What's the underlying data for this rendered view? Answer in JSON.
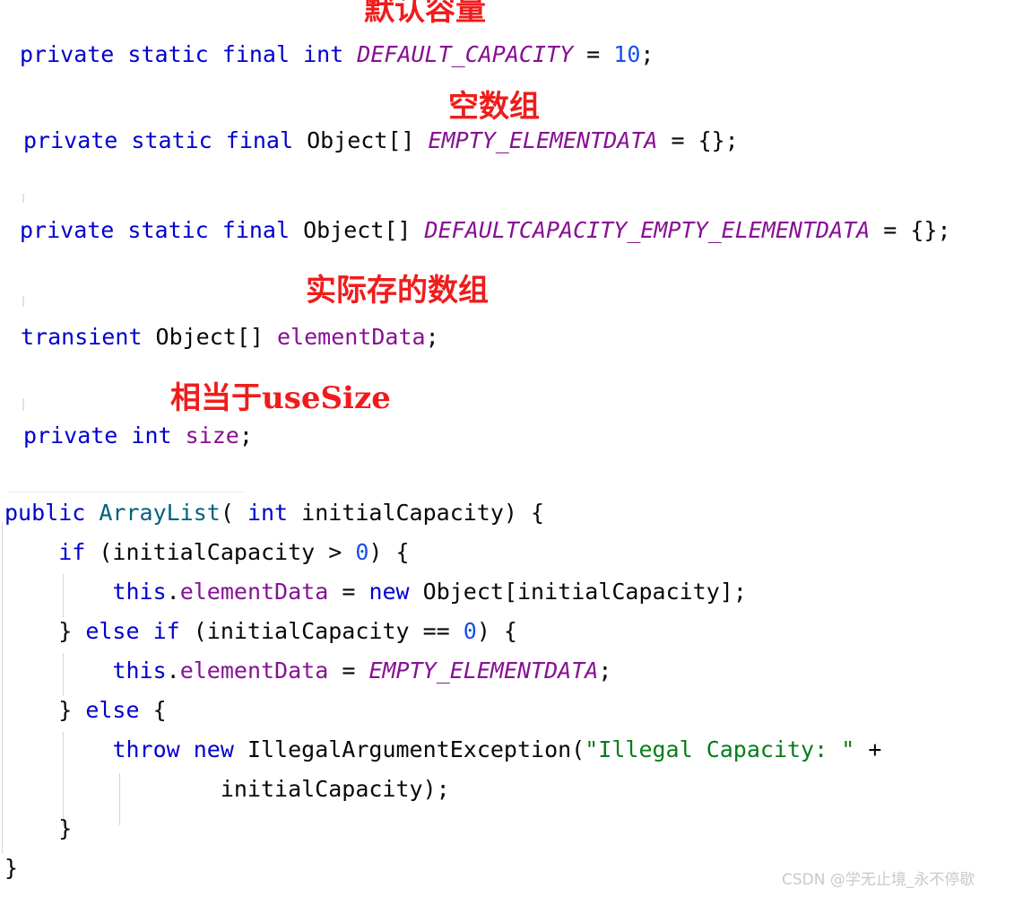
{
  "document": {
    "kind": "code-screenshot",
    "language": "Java",
    "class_context": "ArrayList",
    "background_color": "#ffffff"
  },
  "palette": {
    "keyword": "#0000d0",
    "constant": "#871094",
    "field": "#871094",
    "type": "#00627a",
    "string": "#067d17",
    "number": "#1750eb",
    "plain": "#080808",
    "annotation_red": "#f01c1c",
    "guide_gray": "#d6d6d6",
    "separator_gray": "#ececec",
    "watermark_gray": "#c9c9c9"
  },
  "annotations": [
    {
      "id": "note-default-capacity",
      "text": "默认容量"
    },
    {
      "id": "note-empty-array",
      "text": "空数组"
    },
    {
      "id": "note-actual-array",
      "text": "实际存的数组"
    },
    {
      "id": "note-use-size",
      "text": "相当于useSize"
    }
  ],
  "code": {
    "field_declarations": [
      {
        "id": "line-default-capacity",
        "tokens": [
          {
            "t": "private static final int ",
            "c": "kw"
          },
          {
            "t": "DEFAULT_CAPACITY",
            "c": "cst"
          },
          {
            "t": " = ",
            "c": "pln"
          },
          {
            "t": "10",
            "c": "num"
          },
          {
            "t": ";",
            "c": "pln"
          }
        ]
      },
      {
        "id": "line-empty-elementdata",
        "tokens": [
          {
            "t": "private static final ",
            "c": "kw"
          },
          {
            "t": "Object[] ",
            "c": "pln"
          },
          {
            "t": "EMPTY_ELEMENTDATA",
            "c": "cst"
          },
          {
            "t": " = {};",
            "c": "pln"
          }
        ]
      },
      {
        "id": "line-defaultcapacity-empty-elementdata",
        "tokens": [
          {
            "t": "private static final ",
            "c": "kw"
          },
          {
            "t": "Object[] ",
            "c": "pln"
          },
          {
            "t": "DEFAULTCAPACITY_EMPTY_ELEMENTDATA",
            "c": "cst"
          },
          {
            "t": " = {};",
            "c": "pln"
          }
        ]
      },
      {
        "id": "line-elementdata",
        "tokens": [
          {
            "t": "transient ",
            "c": "kw"
          },
          {
            "t": "Object[] ",
            "c": "pln"
          },
          {
            "t": "elementData",
            "c": "fld"
          },
          {
            "t": ";",
            "c": "pln"
          }
        ]
      },
      {
        "id": "line-size",
        "tokens": [
          {
            "t": "private int ",
            "c": "kw"
          },
          {
            "t": "size",
            "c": "fld"
          },
          {
            "t": ";",
            "c": "pln"
          }
        ]
      }
    ],
    "constructor_lines": [
      {
        "id": "line-ctor-signature",
        "tokens": [
          {
            "t": "public ",
            "c": "kw"
          },
          {
            "t": "ArrayList",
            "c": "typ"
          },
          {
            "t": "( ",
            "c": "pln"
          },
          {
            "t": "int",
            "c": "kw"
          },
          {
            "t": " initialCapacity) {",
            "c": "pln"
          }
        ]
      },
      {
        "id": "line-if-gt-zero",
        "tokens": [
          {
            "t": "    ",
            "c": "pln"
          },
          {
            "t": "if",
            "c": "kw"
          },
          {
            "t": " (initialCapacity > ",
            "c": "pln"
          },
          {
            "t": "0",
            "c": "num"
          },
          {
            "t": ") {",
            "c": "pln"
          }
        ]
      },
      {
        "id": "line-assign-new-object",
        "tokens": [
          {
            "t": "        ",
            "c": "pln"
          },
          {
            "t": "this",
            "c": "kw"
          },
          {
            "t": ".",
            "c": "pln"
          },
          {
            "t": "elementData",
            "c": "fld"
          },
          {
            "t": " = ",
            "c": "pln"
          },
          {
            "t": "new",
            "c": "kw"
          },
          {
            "t": " Object[initialCapacity];",
            "c": "pln"
          }
        ]
      },
      {
        "id": "line-else-if-eq-zero",
        "tokens": [
          {
            "t": "    } ",
            "c": "pln"
          },
          {
            "t": "else if",
            "c": "kw"
          },
          {
            "t": " (initialCapacity == ",
            "c": "pln"
          },
          {
            "t": "0",
            "c": "num"
          },
          {
            "t": ") {",
            "c": "pln"
          }
        ]
      },
      {
        "id": "line-assign-empty",
        "tokens": [
          {
            "t": "        ",
            "c": "pln"
          },
          {
            "t": "this",
            "c": "kw"
          },
          {
            "t": ".",
            "c": "pln"
          },
          {
            "t": "elementData",
            "c": "fld"
          },
          {
            "t": " = ",
            "c": "pln"
          },
          {
            "t": "EMPTY_ELEMENTDATA",
            "c": "cst"
          },
          {
            "t": ";",
            "c": "pln"
          }
        ]
      },
      {
        "id": "line-else",
        "tokens": [
          {
            "t": "    } ",
            "c": "pln"
          },
          {
            "t": "else",
            "c": "kw"
          },
          {
            "t": " {",
            "c": "pln"
          }
        ]
      },
      {
        "id": "line-throw",
        "tokens": [
          {
            "t": "        ",
            "c": "pln"
          },
          {
            "t": "throw new",
            "c": "kw"
          },
          {
            "t": " IllegalArgumentException(",
            "c": "pln"
          },
          {
            "t": "\"Illegal Capacity: \"",
            "c": "str"
          },
          {
            "t": " +",
            "c": "pln"
          }
        ]
      },
      {
        "id": "line-throw-arg",
        "tokens": [
          {
            "t": "                initialCapacity);",
            "c": "pln"
          }
        ]
      },
      {
        "id": "line-close-inner-brace",
        "tokens": [
          {
            "t": "    }",
            "c": "pln"
          }
        ]
      },
      {
        "id": "line-close-outer-brace",
        "tokens": [
          {
            "t": "}",
            "c": "pln"
          }
        ]
      }
    ]
  },
  "watermark": {
    "text": "CSDN @学无止境_永不停歇"
  }
}
